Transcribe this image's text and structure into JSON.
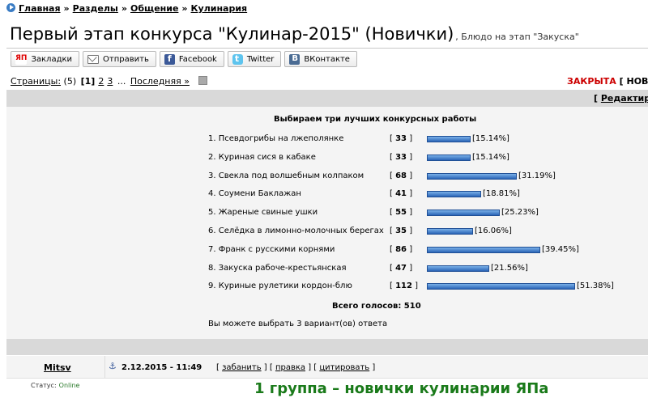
{
  "breadcrumb": [
    "Главная",
    "Разделы",
    "Общение",
    "Кулинария"
  ],
  "breadcrumb_sep": "»",
  "topic": {
    "title": "Первый этап конкурса \"Кулинар-2015\" (Новички)",
    "subtitle": ", Блюдо на этап \"Закуска\""
  },
  "share_buttons": [
    {
      "label": "Закладки",
      "icon": "yap-icon",
      "icon_text": "ЯП"
    },
    {
      "label": "Отправить",
      "icon": "mail-icon"
    },
    {
      "label": "Facebook",
      "icon": "facebook-icon"
    },
    {
      "label": "Twitter",
      "icon": "twitter-icon"
    },
    {
      "label": "ВКонтакте",
      "icon": "vkontakte-icon"
    }
  ],
  "pagination": {
    "label": "Страницы:",
    "count": "(5)",
    "current": "[1]",
    "pages": [
      "2",
      "3"
    ],
    "ellipsis": "...",
    "last": "Последняя »"
  },
  "topic_status": {
    "closed": "ЗАКРЫТА",
    "new_reply": "[ НОВА"
  },
  "edit_link": {
    "open": "[ ",
    "label": "Редактире"
  },
  "poll": {
    "question": "Выбираем три лучших конкурсных работы",
    "options": [
      {
        "name": "1. Псевдогрибы на лжеполянке",
        "votes": "33",
        "percent": "[15.14%]",
        "fraction": 0.1514
      },
      {
        "name": "2. Куриная сися в кабаке",
        "votes": "33",
        "percent": "[15.14%]",
        "fraction": 0.1514
      },
      {
        "name": "3. Свекла под волшебным колпаком",
        "votes": "68",
        "percent": "[31.19%]",
        "fraction": 0.3119
      },
      {
        "name": "4. Соумени Баклажан",
        "votes": "41",
        "percent": "[18.81%]",
        "fraction": 0.1881
      },
      {
        "name": "5. Жареные свиные ушки",
        "votes": "55",
        "percent": "[25.23%]",
        "fraction": 0.2523
      },
      {
        "name": "6. Селёдка в лимонно-молочных берегах",
        "votes": "35",
        "percent": "[16.06%]",
        "fraction": 0.1606
      },
      {
        "name": "7. Франк с русскими корнями",
        "votes": "86",
        "percent": "[39.45%]",
        "fraction": 0.3945
      },
      {
        "name": "8. Закуска рабоче-крестьянская",
        "votes": "47",
        "percent": "[21.56%]",
        "fraction": 0.2156
      },
      {
        "name": "9. Куриные рулетики кордон-блю",
        "votes": "112",
        "percent": "[51.38%]",
        "fraction": 0.5138
      }
    ],
    "total": "Всего голосов: 510",
    "choose_note": "Вы можете выбрать 3 вариант(ов) ответа"
  },
  "post": {
    "author": "Mitsv",
    "date": "2.12.2015 - 11:49",
    "actions": [
      "забанить",
      "правка",
      "цитировать"
    ],
    "status_label": "Статус:",
    "status_value": "Online",
    "headline": "1 группа – новички кулинарии ЯПа"
  },
  "colors": {
    "closed": "#cc0000",
    "poll_bar": "#2a64b6",
    "headline": "#1a7a1a",
    "online": "#2a7a2a"
  }
}
